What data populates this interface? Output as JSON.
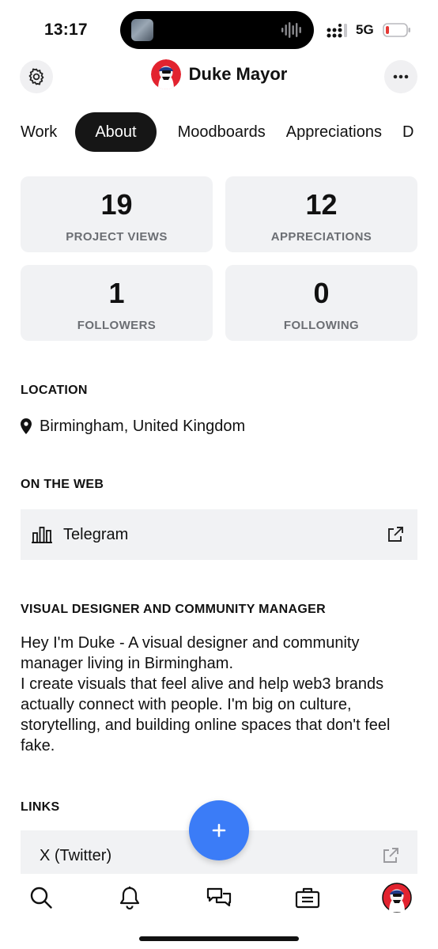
{
  "status_bar": {
    "time": "13:17",
    "network": "5G",
    "icons": [
      "signal-icon",
      "battery-icon"
    ]
  },
  "header": {
    "name": "Duke Mayor",
    "icons": [
      "gear-icon",
      "more-icon",
      "avatar"
    ]
  },
  "tabs": [
    {
      "label": "Work",
      "active": false
    },
    {
      "label": "About",
      "active": true
    },
    {
      "label": "Moodboards",
      "active": false
    },
    {
      "label": "Appreciations",
      "active": false
    },
    {
      "label": "D",
      "active": false
    }
  ],
  "stats": [
    {
      "value": "19",
      "label": "PROJECT VIEWS"
    },
    {
      "value": "12",
      "label": "APPRECIATIONS"
    },
    {
      "value": "1",
      "label": "FOLLOWERS"
    },
    {
      "value": "0",
      "label": "FOLLOWING"
    }
  ],
  "location": {
    "title": "LOCATION",
    "value": "Birmingham, United Kingdom"
  },
  "on_the_web": {
    "title": "ON THE WEB",
    "items": [
      {
        "label": "Telegram"
      }
    ]
  },
  "about": {
    "title": "VISUAL DESIGNER AND COMMUNITY MANAGER",
    "bio_line1": "Hey I'm Duke -  A visual designer and community manager living in Birmingham.",
    "bio_line2": "I create visuals that feel alive and help web3 brands actually connect with people. I'm big on culture, storytelling, and building online spaces that don't feel fake."
  },
  "links": {
    "title": "LINKS",
    "items": [
      {
        "label": "X (Twitter)"
      }
    ]
  },
  "fab": {
    "label": "+"
  },
  "nav": {
    "items": [
      "search-icon",
      "bell-icon",
      "messages-icon",
      "briefcase-icon",
      "profile-avatar"
    ]
  },
  "colors": {
    "accent": "#3b7cf7",
    "card_bg": "#f1f2f4",
    "active_tab": "#161616",
    "muted_text": "#6b6e73"
  }
}
